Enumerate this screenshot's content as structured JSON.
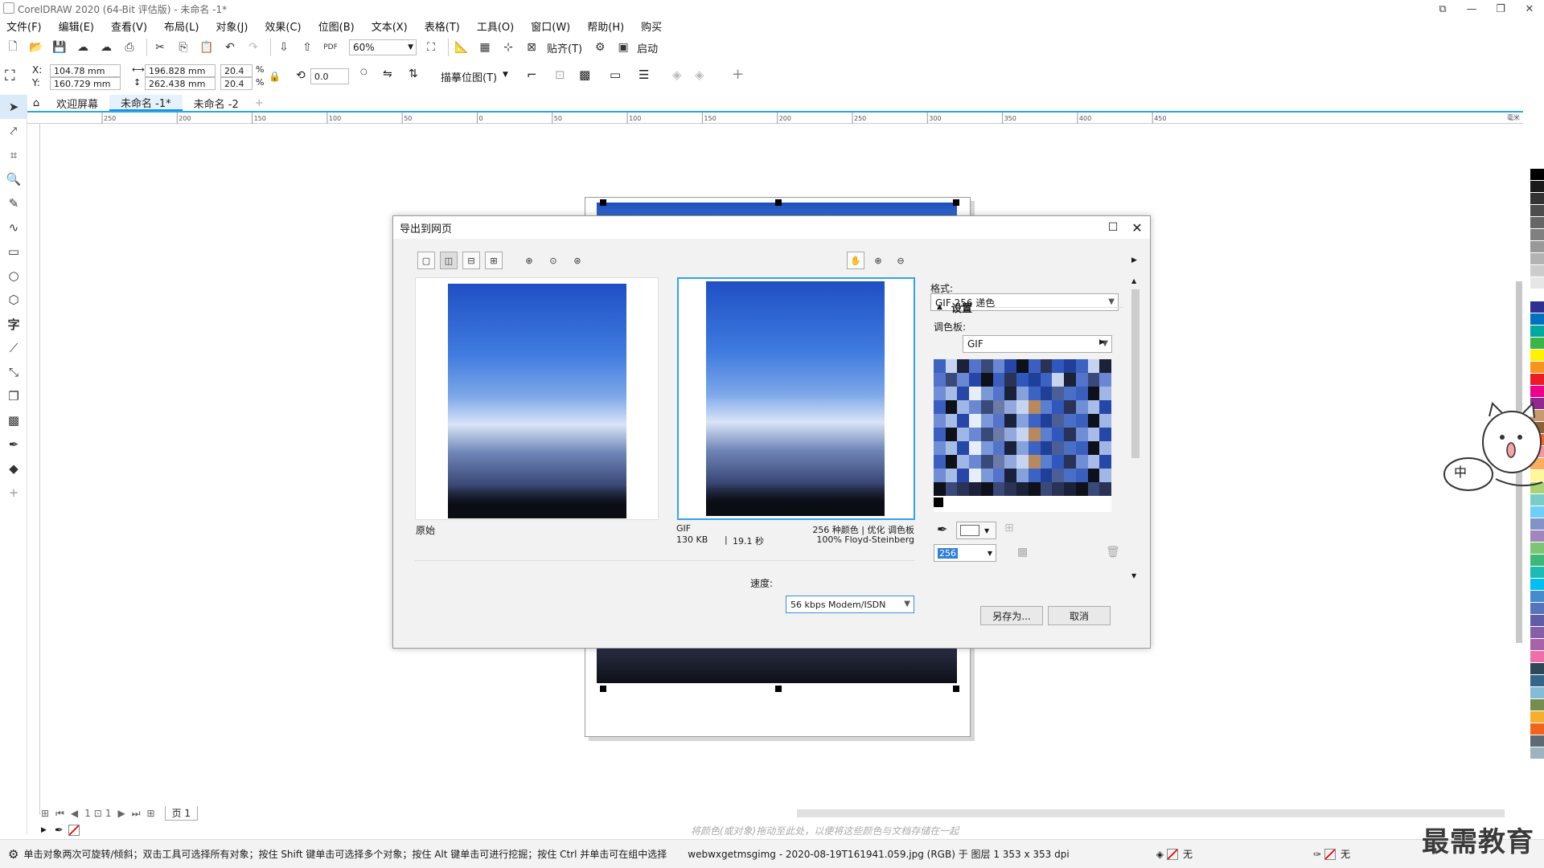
{
  "app": {
    "title": "CorelDRAW 2020 (64-Bit 评估版) - 未命名 -1*"
  },
  "menu": [
    "文件(F)",
    "编辑(E)",
    "查看(V)",
    "布局(L)",
    "对象(J)",
    "效果(C)",
    "位图(B)",
    "文本(X)",
    "表格(T)",
    "工具(O)",
    "窗口(W)",
    "帮助(H)",
    "购买"
  ],
  "toolbar": {
    "zoom": "60%",
    "snap_label": "贴齐(T)",
    "launch_label": "启动"
  },
  "props": {
    "x_label": "X:",
    "y_label": "Y:",
    "x": "104.78 mm",
    "y": "160.729 mm",
    "w": "196.828 mm",
    "h": "262.438 mm",
    "sx": "20.4",
    "sy": "20.4",
    "pct": "%",
    "rotation": "0.0",
    "trace_label": "描摹位图(T)"
  },
  "tabs": [
    "欢迎屏幕",
    "未命名 -1*",
    "未命名 -2"
  ],
  "ruler": [
    "250",
    "200",
    "150",
    "100",
    "50",
    "0",
    "50",
    "100",
    "150",
    "200",
    "250",
    "300",
    "350",
    "400",
    "450"
  ],
  "ruler_unit": "毫米",
  "dialog": {
    "title": "导出到网页",
    "original_label": "原始",
    "format_name": "GIF",
    "file_size": "130 KB",
    "time": "19.1 秒",
    "colors_info": "256 种颜色 | 优化 调色板",
    "dither_info": "100% Floyd-Steinberg",
    "speed_label": "速度:",
    "speed_value": "56 kbps Modem/ISDN",
    "preset": "GIF 256 递色",
    "format_label": "格式:",
    "format_value": "GIF",
    "settings_label": "设置",
    "palette_label": "调色板:",
    "palette_value": "优化",
    "color_count": "256",
    "save_as": "另存为...",
    "cancel": "取消"
  },
  "pagenav": {
    "page_tab": "页 1",
    "count1": "1",
    "count2": "1"
  },
  "hint": "将颜色(或对象)拖动至此处，以便将这些颜色与文档存储在一起",
  "status": {
    "message": "单击对象两次可旋转/倾斜；双击工具可选择所有对象；按住 Shift 键单击可选择多个对象；按住 Alt 键单击可进行挖掘；按住 Ctrl 并单击可在组中选择",
    "file_info": "webwxgetmsgimg - 2020-08-19T161941.059.jpg (RGB) 于 图层 1 353 x 353 dpi",
    "fill_none": "无",
    "outline_none": "无"
  },
  "watermark": "最需教育",
  "ime": {
    "label": "中"
  },
  "palette_colors": [
    "#ffffff",
    "#000000",
    "#1a1a1a",
    "#333333",
    "#4d4d4d",
    "#666666",
    "#808080",
    "#999999",
    "#b3b3b3",
    "#cccccc",
    "#e6e6e6",
    "#ffffff",
    "#2e3192",
    "#0071bc",
    "#00a99d",
    "#39b54a",
    "#fff200",
    "#f7941d",
    "#ed1c24",
    "#ec008c",
    "#92278f",
    "#c69c6d",
    "#8c6239",
    "#f26522",
    "#f5989d",
    "#fbaf5d",
    "#fff799",
    "#acd373",
    "#7accc8",
    "#6dcff6",
    "#8393ca",
    "#a186be",
    "#7cc576",
    "#3cb878",
    "#1cbbb4",
    "#00bff3",
    "#448ccb",
    "#5674b9",
    "#605ca8",
    "#855fa8",
    "#a763a8",
    "#f06eaa",
    "#2f4858",
    "#33658a",
    "#86bbd8",
    "#758e4f",
    "#f6ae2d",
    "#f26419",
    "#5c6b73",
    "#9db4c0"
  ],
  "swatch_colors": [
    "#6f8ed6",
    "#86a2dd",
    "#9fb6e6",
    "#5b7fcf",
    "#7b98d9",
    "#4a6fc7",
    "#92a9e0",
    "#a7bde8",
    "#3c63c2",
    "#6987d3",
    "#2f57bd",
    "#5474cb",
    "#3a5fbf",
    "#c7d4ef",
    "#2647a8",
    "#1f3f98",
    "#3a4a78",
    "#2a3356",
    "#1b2138",
    "#0e1119",
    "#b58a5e",
    "#e8eef9",
    "#4b5e96",
    "#6b7aa6"
  ]
}
